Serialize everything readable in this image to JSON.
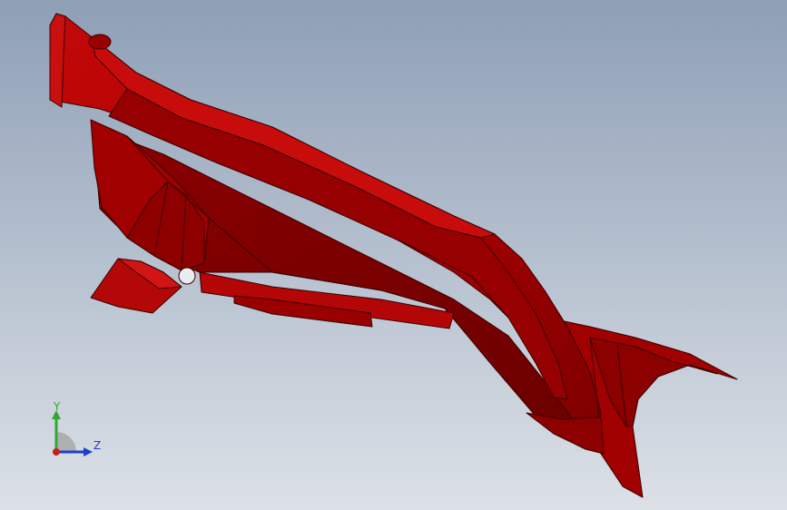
{
  "viewport": {
    "background_top": "#8E9FB6",
    "background_bottom": "#DCE1E7"
  },
  "model": {
    "color": "#B00000",
    "edge_color": "#3A0000"
  },
  "triad": {
    "y_label": "Y",
    "z_label": "Z",
    "y_color": "#2FA82F",
    "z_color": "#1F3FC8",
    "x_color": "#C81E1E"
  }
}
